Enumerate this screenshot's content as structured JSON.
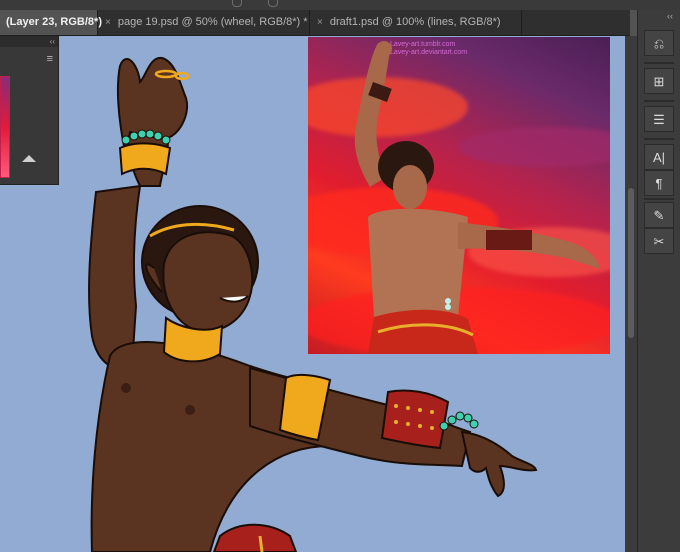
{
  "tabs": [
    {
      "label": "(Layer 23, RGB/8*)",
      "active": true
    },
    {
      "close": "×",
      "label": "page 19.psd @ 50% (wheel, RGB/8*) *",
      "active": false
    },
    {
      "close": "×",
      "label": "draft1.psd @ 100% (lines, RGB/8*)",
      "active": false
    }
  ],
  "panel": {
    "collapse": "‹‹",
    "menu": "≡"
  },
  "dock": {
    "collapse": "‹‹",
    "tools": [
      {
        "name": "history-icon",
        "glyph": "⎌"
      },
      {
        "name": "libraries-icon",
        "glyph": "⊞"
      },
      {
        "name": "adjustments-icon",
        "glyph": "☰"
      },
      {
        "name": "character-icon",
        "glyph": "A|"
      },
      {
        "name": "paragraph-icon",
        "glyph": "¶"
      },
      {
        "name": "brush-settings-icon",
        "glyph": "✎"
      },
      {
        "name": "clone-source-icon",
        "glyph": "✂"
      }
    ]
  },
  "reference": {
    "watermark_line1": "Lavey-art.tumblr.com",
    "watermark_line2": "Lavey-art.deviantart.com"
  },
  "colors": {
    "canvas": "#92abd2",
    "skin": "#5a3420",
    "gold": "#f0a81c",
    "beads": "#3fd0b0",
    "red_sleeve": "#a8201c"
  }
}
